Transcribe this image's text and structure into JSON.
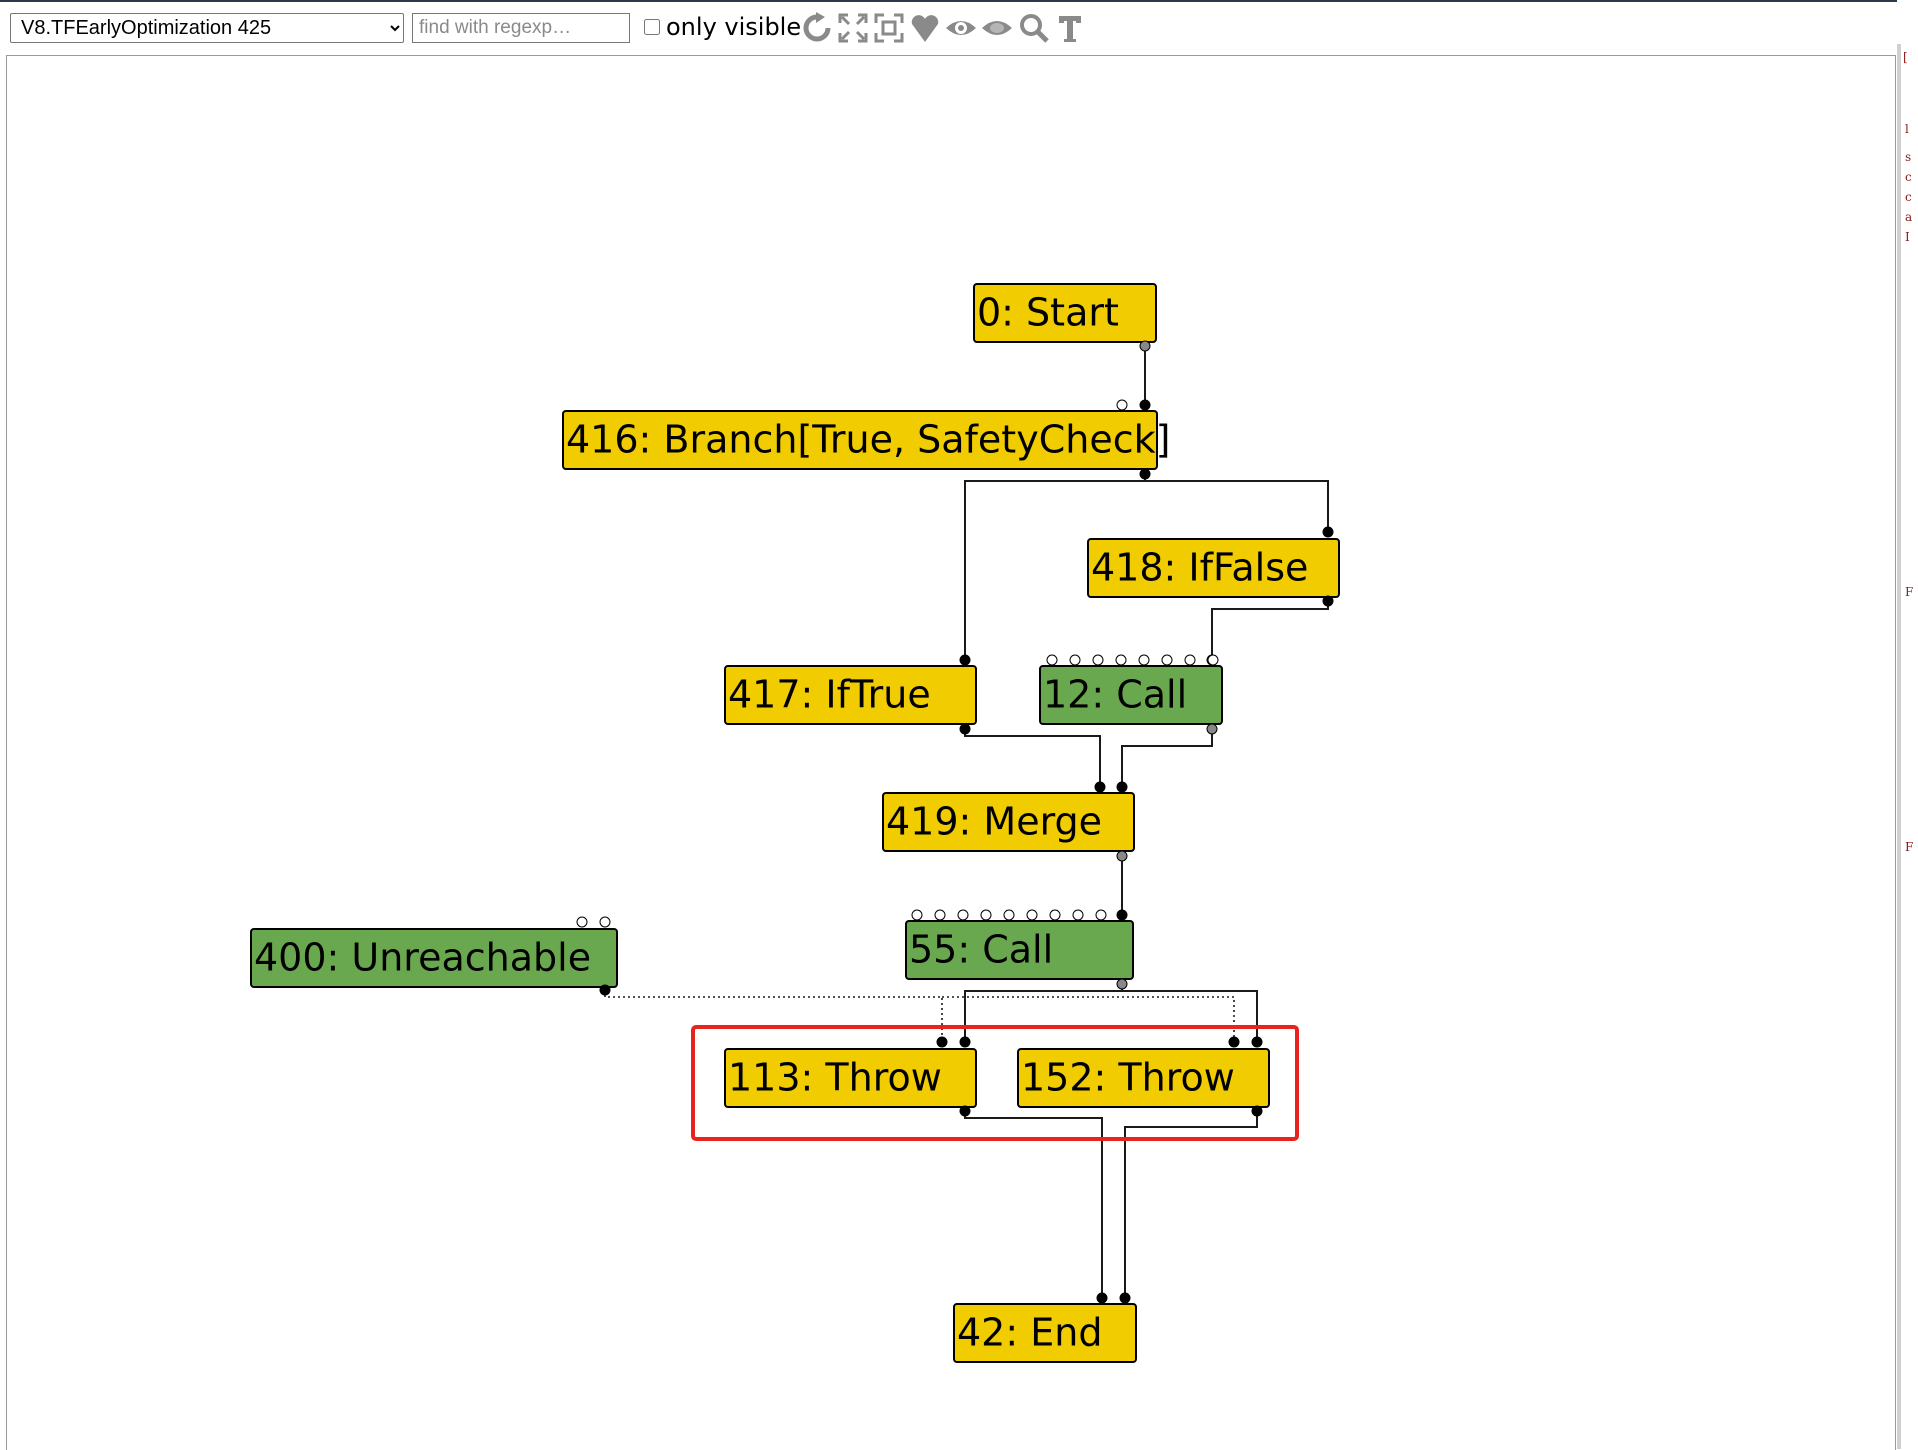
{
  "toolbar": {
    "phase_selected": "V8.TFEarlyOptimization 425",
    "search_placeholder": "find with regexp…",
    "only_visible_label": "only visible",
    "icons": [
      "layout-icon",
      "show-all-icon",
      "fit-icon",
      "toggle-types-icon",
      "show-selected-icon",
      "hide-dead-icon",
      "zoom-icon",
      "toggle-text-icon"
    ]
  },
  "graph": {
    "nodes": [
      {
        "id": "start",
        "label": "0: Start",
        "color": "#f0cc00"
      },
      {
        "id": "branch",
        "label": "416: Branch[True, SafetyCheck]",
        "color": "#f0cc00"
      },
      {
        "id": "iffalse",
        "label": "418: IfFalse",
        "color": "#f0cc00"
      },
      {
        "id": "iftrue",
        "label": "417: IfTrue",
        "color": "#f0cc00"
      },
      {
        "id": "call12",
        "label": "12: Call",
        "color": "#6aa84f"
      },
      {
        "id": "merge",
        "label": "419: Merge",
        "color": "#f0cc00"
      },
      {
        "id": "unreachable",
        "label": "400: Unreachable",
        "color": "#6aa84f"
      },
      {
        "id": "call55",
        "label": "55: Call",
        "color": "#6aa84f"
      },
      {
        "id": "throw113",
        "label": "113: Throw",
        "color": "#f0cc00"
      },
      {
        "id": "throw152",
        "label": "152: Throw",
        "color": "#f0cc00"
      },
      {
        "id": "end",
        "label": "42: End",
        "color": "#f0cc00"
      }
    ],
    "highlight_color": "#e8221c"
  }
}
